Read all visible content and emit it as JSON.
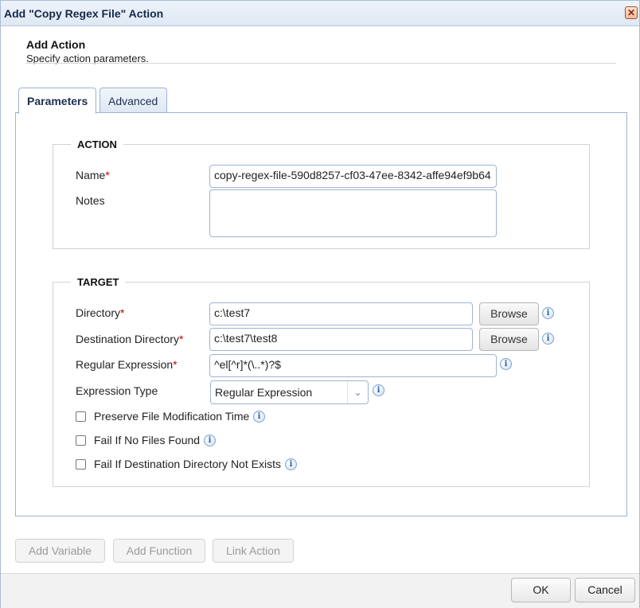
{
  "window": {
    "title": "Add \"Copy Regex File\" Action",
    "close_symbol": "✕"
  },
  "header": {
    "title": "Add Action",
    "subtitle": "Specify action parameters."
  },
  "tabs": [
    {
      "label": "Parameters",
      "active": true
    },
    {
      "label": "Advanced",
      "active": false
    }
  ],
  "action_group": {
    "legend": "ACTION",
    "name_label": "Name",
    "name_value": "copy-regex-file-590d8257-cf03-47ee-8342-affe94ef9b64",
    "notes_label": "Notes",
    "notes_value": ""
  },
  "target_group": {
    "legend": "TARGET",
    "directory_label": "Directory",
    "directory_value": "c:\\test7",
    "dest_directory_label": "Destination Directory",
    "dest_directory_value": "c:\\test7\\test8",
    "regex_label": "Regular Expression",
    "regex_value": "^el[^r]*(\\..*)?$",
    "expression_type_label": "Expression Type",
    "expression_type_value": "Regular Expression",
    "browse_label": "Browse",
    "required_mark": "*",
    "checkboxes": [
      {
        "label": "Preserve File Modification Time",
        "checked": false
      },
      {
        "label": "Fail If No Files Found",
        "checked": false
      },
      {
        "label": "Fail If Destination Directory Not Exists",
        "checked": false
      }
    ]
  },
  "info_symbol": "i",
  "dropdown_symbol": "⌄",
  "bottom_buttons": {
    "add_variable": "Add Variable",
    "add_function": "Add Function",
    "link_action": "Link Action"
  },
  "footer": {
    "ok": "OK",
    "cancel": "Cancel"
  }
}
